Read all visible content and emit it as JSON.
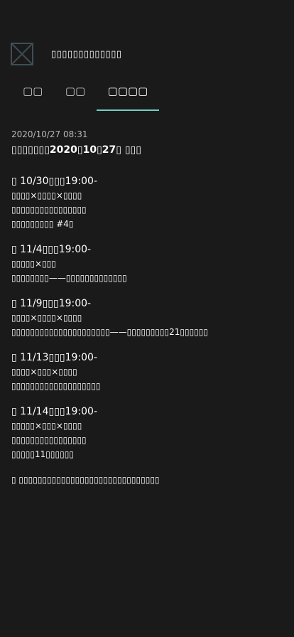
{
  "header": {
    "logo_icon": "image-placeholder-icon",
    "title": "▯▯▯▯▯▯▯▯▯▯▯▯▯"
  },
  "tabs": [
    {
      "label": "▢▢",
      "active": false
    },
    {
      "label": "▢▢",
      "active": false
    },
    {
      "label": "▢▢▢▢",
      "active": true
    }
  ],
  "accent_color": "#6fd3c2",
  "post": {
    "date": "2020/10/27 08:31",
    "title": "▯▯▯▯▯▯▯2020▯10▯27▯ ▯▯▯"
  },
  "events": [
    {
      "lines": [
        "▯ 10/30▯▯▯19:00-",
        "▯▯▯▯×▯▯▯▯×▯▯▯▯",
        "▯▯▯▯▯▯▯▯▯▯▯▯▯▯▯▯",
        "▯▯▯▯▯▯▯▯▯ #4▯"
      ]
    },
    {
      "lines": [
        "▯ 11/4▯▯▯19:00-",
        "▯▯▯▯▯×▯▯▯",
        "▯▯▯▯▯▯▯▯——▯▯▯▯▯▯▯▯▯▯▯▯▯"
      ]
    },
    {
      "lines": [
        "▯ 11/9▯▯▯19:00-",
        "▯▯▯▯×▯▯▯▯×▯▯▯▯",
        "▯▯▯▯▯▯▯▯▯▯▯▯▯▯▯▯▯▯▯▯▯——▯▯▯▯▯▯▯▯▯21▯▯▯▯▯▯"
      ]
    },
    {
      "lines": [
        "▯ 11/13▯▯▯19:00-",
        "▯▯▯▯×▯▯▯×▯▯▯▯",
        "▯▯▯▯▯▯▯▯▯▯▯▯▯▯▯▯▯▯▯"
      ]
    },
    {
      "lines": [
        "▯ 11/14▯▯▯19:00-",
        "▯▯▯▯▯×▯▯▯×▯▯▯▯",
        "▯▯▯▯▯▯▯▯▯▯▯▯▯▯▯▯",
        "▯▯▯▯▯11▯▯▯▯▯▯"
      ]
    }
  ],
  "note": "▯ ▯▯▯▯▯▯▯▯▯▯▯▯▯▯▯▯▯▯▯▯▯▯▯▯▯▯▯▯▯▯"
}
